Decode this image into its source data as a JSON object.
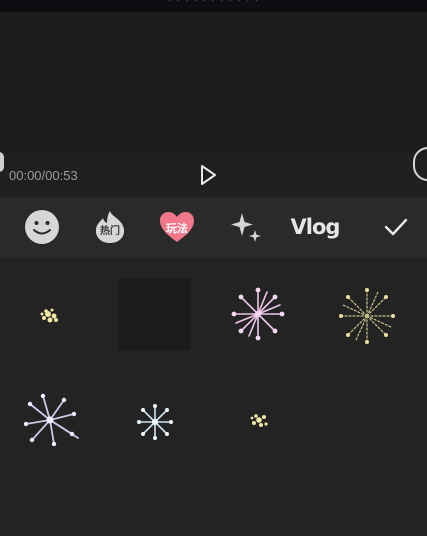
{
  "status_bar": {
    "title_text": "· · · · · · · · · · ·"
  },
  "player": {
    "timecode": "00:00/00:53",
    "play_icon": "play-icon"
  },
  "tabs": [
    {
      "name": "emoji",
      "icon": "smiley-icon"
    },
    {
      "name": "hot",
      "label": "热门"
    },
    {
      "name": "play",
      "label": "玩法"
    },
    {
      "name": "sparkle",
      "icon": "sparkle-icon"
    },
    {
      "name": "vlog",
      "label": "Vlog"
    },
    {
      "name": "confirm",
      "icon": "check-icon"
    }
  ],
  "stickers": [
    {
      "name": "firework-small-yellow"
    },
    {
      "name": "blank-selected"
    },
    {
      "name": "firework-pink"
    },
    {
      "name": "firework-gold"
    },
    {
      "name": "firework-purple-white"
    },
    {
      "name": "firework-blue-white"
    },
    {
      "name": "firework-tiny-yellow"
    }
  ],
  "colors": {
    "accent_pink": "#f0788a",
    "icon_gray": "#d6d6d6",
    "background": "#232323"
  }
}
